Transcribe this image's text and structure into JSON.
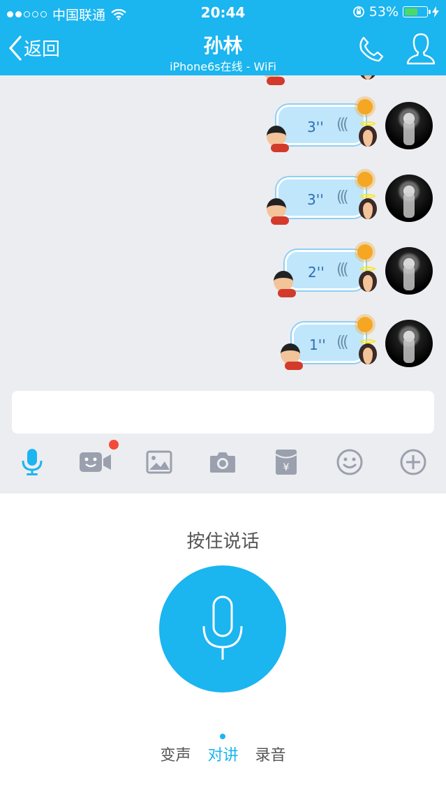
{
  "status": {
    "carrier": "中国联通",
    "time": "20:44",
    "battery": "53%",
    "battery_level": 0.53
  },
  "header": {
    "back": "返回",
    "title": "孙林",
    "subtitle": "iPhone6s在线 - WiFi"
  },
  "messages": [
    {
      "duration": "3''"
    },
    {
      "duration": "3''"
    },
    {
      "duration": "2''"
    },
    {
      "duration": "1''"
    }
  ],
  "input": {
    "value": "",
    "placeholder": ""
  },
  "toolbar": [
    "mic-icon",
    "video-icon",
    "image-icon",
    "camera-icon",
    "red-packet-icon",
    "emoji-icon",
    "plus-icon"
  ],
  "voice": {
    "hint": "按住说话",
    "modes": [
      "变声",
      "对讲",
      "录音"
    ],
    "active_mode": "对讲"
  },
  "colors": {
    "accent": "#1bb5f0",
    "badge": "#f54a3a",
    "battery": "#4cd964"
  }
}
